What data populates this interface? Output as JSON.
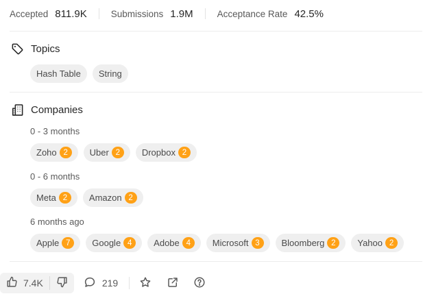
{
  "stats": [
    {
      "label": "Accepted",
      "value": "811.9K"
    },
    {
      "label": "Submissions",
      "value": "1.9M"
    },
    {
      "label": "Acceptance Rate",
      "value": "42.5%"
    }
  ],
  "topics": {
    "title": "Topics",
    "tags": [
      "Hash Table",
      "String"
    ]
  },
  "companies": {
    "title": "Companies",
    "groups": [
      {
        "period": "0 - 3 months",
        "items": [
          {
            "name": "Zoho",
            "count": "2"
          },
          {
            "name": "Uber",
            "count": "2"
          },
          {
            "name": "Dropbox",
            "count": "2"
          }
        ]
      },
      {
        "period": "0 - 6 months",
        "items": [
          {
            "name": "Meta",
            "count": "2"
          },
          {
            "name": "Amazon",
            "count": "2"
          }
        ]
      },
      {
        "period": "6 months ago",
        "items": [
          {
            "name": "Apple",
            "count": "7"
          },
          {
            "name": "Google",
            "count": "4"
          },
          {
            "name": "Adobe",
            "count": "4"
          },
          {
            "name": "Microsoft",
            "count": "3"
          },
          {
            "name": "Bloomberg",
            "count": "2"
          },
          {
            "name": "Yahoo",
            "count": "2"
          }
        ]
      }
    ]
  },
  "actions": {
    "likes": "7.4K",
    "comments": "219"
  },
  "colors": {
    "badge": "#ffa116",
    "chip_bg": "#efefef"
  }
}
